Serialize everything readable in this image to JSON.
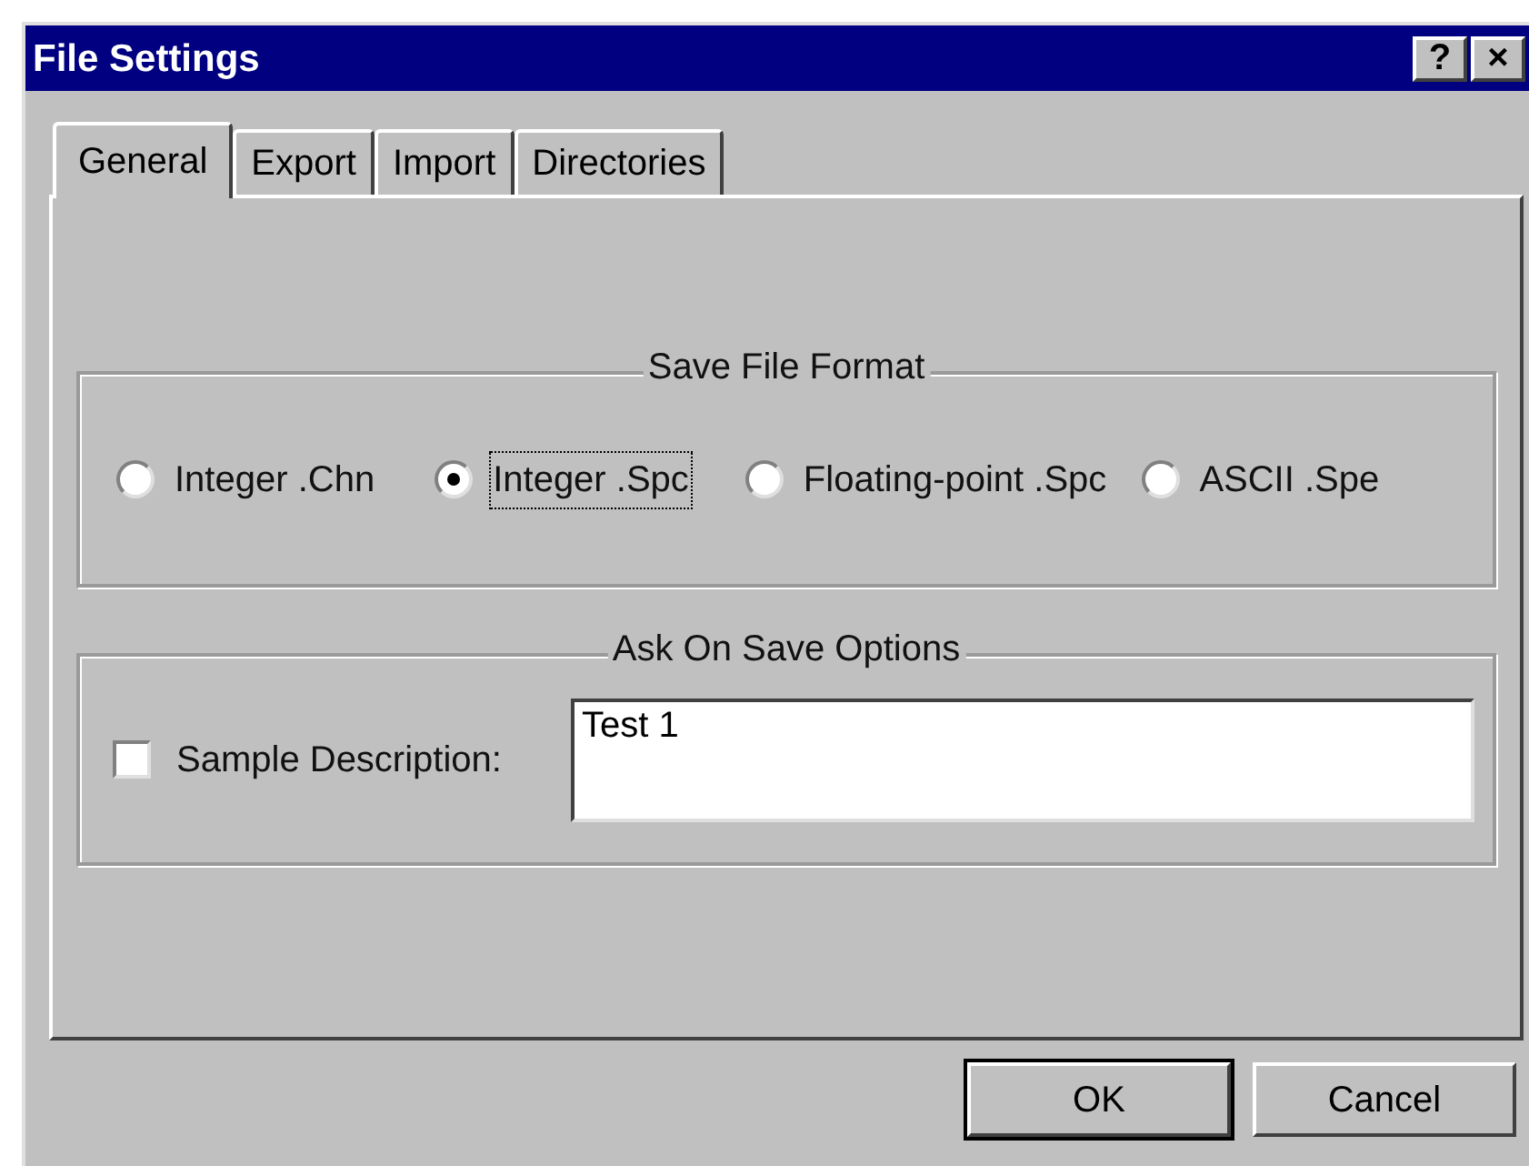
{
  "window": {
    "title": "File Settings",
    "title_buttons": [
      "?",
      "×"
    ]
  },
  "tabs": [
    {
      "label": "General",
      "selected": true
    },
    {
      "label": "Export",
      "selected": false
    },
    {
      "label": "Import",
      "selected": false
    },
    {
      "label": "Directories",
      "selected": false
    }
  ],
  "save_file_format": {
    "title": "Save File Format",
    "options": [
      {
        "label": "Integer .Chn",
        "selected": false
      },
      {
        "label": "Integer .Spc",
        "selected": true
      },
      {
        "label": "Floating-point .Spc",
        "selected": false
      },
      {
        "label": "ASCII .Spe",
        "selected": false
      }
    ]
  },
  "ask_on_save_options": {
    "title": "Ask On Save Options",
    "sample_description": {
      "label": "Sample Description:",
      "checked": false,
      "value": "Test 1"
    }
  },
  "buttons": [
    {
      "label": "OK",
      "default": true
    },
    {
      "label": "Cancel",
      "default": false
    }
  ]
}
